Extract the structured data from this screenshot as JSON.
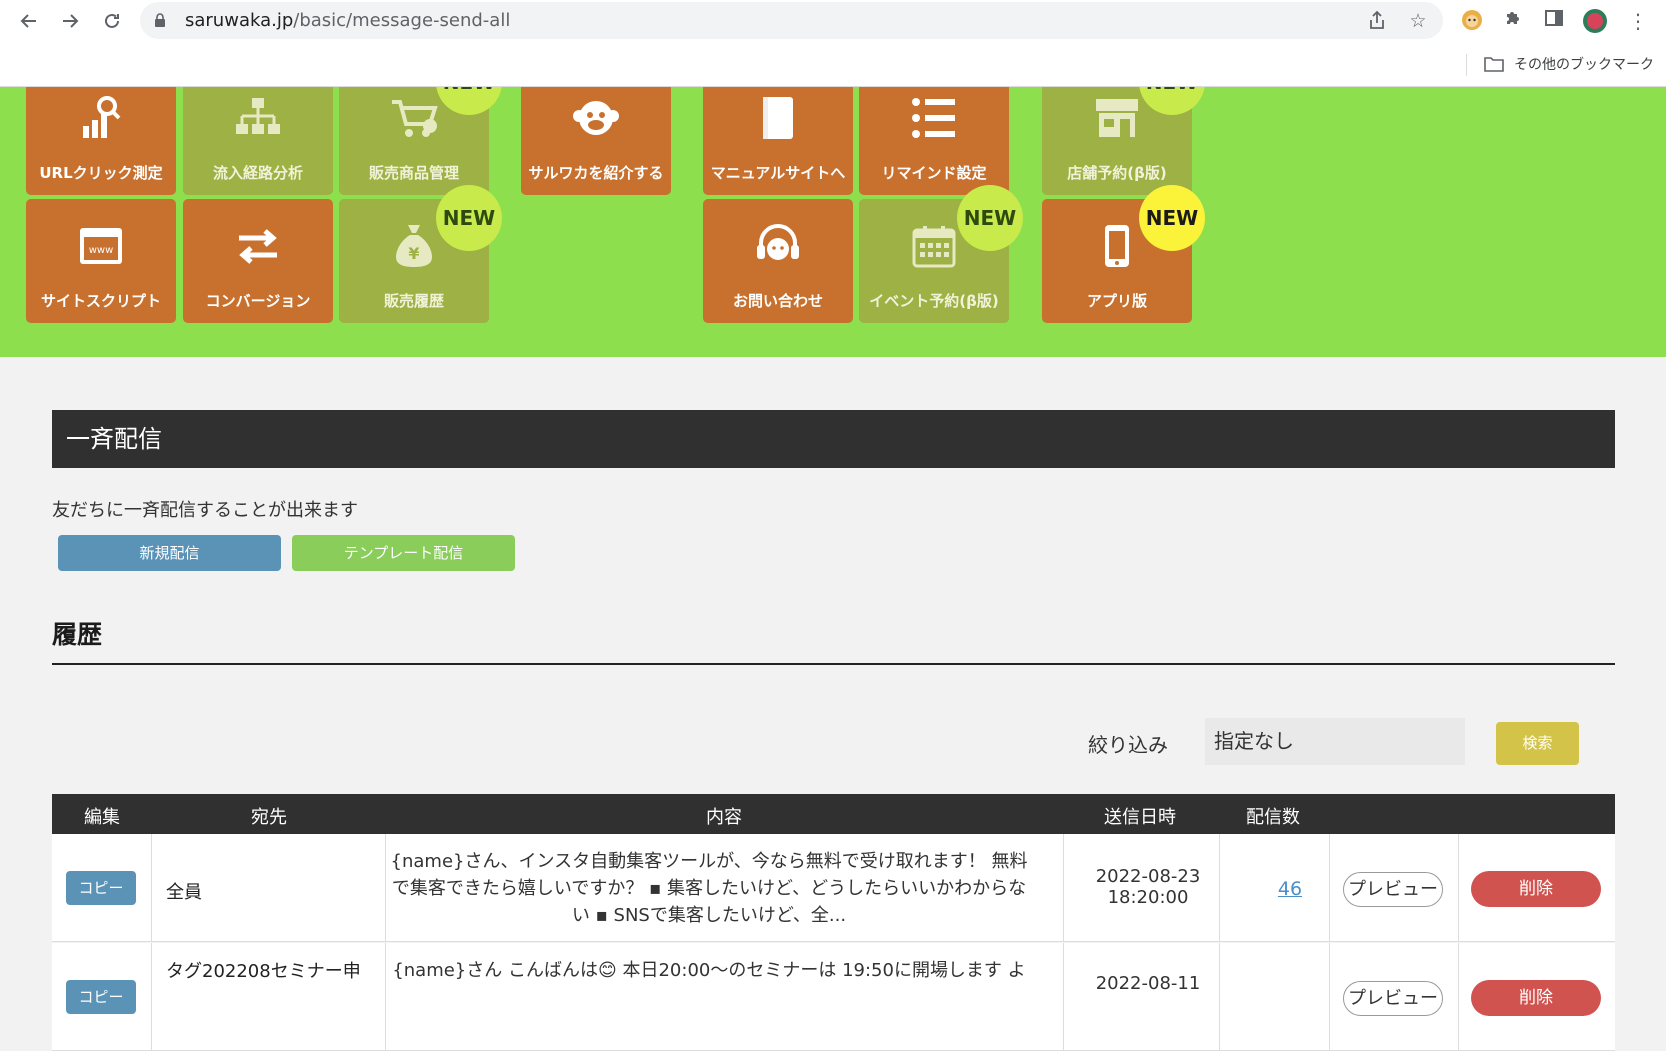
{
  "browser": {
    "url_host": "saruwaka.jp",
    "url_path": "/basic/message-send-all",
    "bookmarks_label": "その他のブックマーク"
  },
  "menu": {
    "tiles": [
      {
        "label": "URLクリック測定",
        "icon": "chart-search-icon",
        "state": "active"
      },
      {
        "label": "流入経路分析",
        "icon": "sitemap-icon",
        "state": "dim"
      },
      {
        "label": "販売商品管理",
        "icon": "cart-icon",
        "state": "dim",
        "badge": "NEW"
      },
      {
        "label": "サルワカを紹介する",
        "icon": "monkey-icon",
        "state": "active"
      },
      {
        "label": "マニュアルサイトへ",
        "icon": "book-icon",
        "state": "active"
      },
      {
        "label": "リマインド設定",
        "icon": "list-icon",
        "state": "active"
      },
      {
        "label": "店舗予約(β版)",
        "icon": "store-icon",
        "state": "dim",
        "badge": "NEW"
      },
      {
        "label": "サイトスクリプト",
        "icon": "www-icon",
        "state": "active"
      },
      {
        "label": "コンバージョン",
        "icon": "exchange-icon",
        "state": "active"
      },
      {
        "label": "販売履歴",
        "icon": "money-bag-icon",
        "state": "dim",
        "badge": "NEW"
      },
      {
        "label": "お問い合わせ",
        "icon": "headset-icon",
        "state": "active"
      },
      {
        "label": "イベント予約(β版)",
        "icon": "calendar-icon",
        "state": "dim",
        "badge": "NEW"
      },
      {
        "label": "アプリ版",
        "icon": "smartphone-icon",
        "state": "active",
        "badge": "NEW"
      }
    ]
  },
  "page": {
    "title": "一斉配信",
    "description": "友だちに一斉配信することが出来ます",
    "new_button": "新規配信",
    "template_button": "テンプレート配信"
  },
  "history": {
    "title": "履歴",
    "filter_label": "絞り込み",
    "filter_value": "指定なし",
    "search_button": "検索",
    "columns": [
      "編集",
      "宛先",
      "内容",
      "送信日時",
      "配信数"
    ],
    "rows": [
      {
        "copy": "コピー",
        "destination": "全員",
        "content": "{name}さん、インスタ自動集客ツールが、今なら無料で受け取れます！ 無料で集客できたら嬉しいですか？ ▪ 集客したいけど、どうしたらいいかわからない ▪ SNSで集客したいけど、全...",
        "date": "2022-08-23",
        "time": "18:20:00",
        "count": "46",
        "preview": "プレビュー",
        "delete": "削除"
      },
      {
        "copy": "コピー",
        "destination": "タグ202208セミナー申",
        "content": "{name}さん こんばんは😊 本日20:00〜のセミナーは 19:50に開場します よ",
        "date": "2022-08-11",
        "time": "",
        "count": "",
        "preview": "プレビュー",
        "delete": "削除"
      }
    ]
  }
}
